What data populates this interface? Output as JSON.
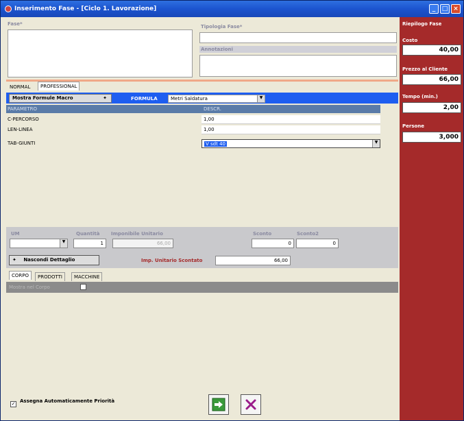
{
  "window": {
    "title": "Inserimento Fase - [Ciclo 1. Lavorazione]"
  },
  "form": {
    "fase_label": "Fase*",
    "tipologia_label": "Tipologia Fase*",
    "annotazioni_label": "Annotazioni"
  },
  "tabs_top": [
    "NORMAL",
    "PROFESSIONAL"
  ],
  "macro": {
    "toggle_label": "Mostra Formule Macro",
    "formula_label": "FORMULA",
    "formula_value": "Metri Saldatura"
  },
  "grid": {
    "headers": [
      "PARAMETRO",
      "DESCR."
    ],
    "rows": [
      {
        "param": "C-PERCORSO",
        "value": "1,00"
      },
      {
        "param": "LEN-LINEA",
        "value": "1,00"
      },
      {
        "param": "TAB-GIUNTI",
        "value": "V sdt 40"
      }
    ]
  },
  "detail": {
    "um_label": "UM",
    "quantita_label": "Quantità",
    "quantita_value": "1",
    "imponibile_label": "Imponibile Unitario",
    "imponibile_value": "66,00",
    "sconto_label": "Sconto",
    "sconto_value": "0",
    "sconto2_label": "Sconto2",
    "sconto2_value": "0",
    "hide_label": "Nascondi Dettaglio",
    "imp_scontato_label": "Imp. Unitario Scontato",
    "imp_scontato_value": "66,00"
  },
  "tabs_bottom": [
    "CORPO",
    "PRODOTTI",
    "MACCHINE"
  ],
  "corpo": {
    "mostra_label": "Mostra nel Corpo"
  },
  "riepilogo": {
    "title": "Riepilogo Fase",
    "costo_label": "Costo",
    "costo_value": "40,00",
    "prezzo_label": "Prezzo al Cliente",
    "prezzo_value": "66,00",
    "tempo_label": "Tempo (min.)",
    "tempo_value": "2,00",
    "persone_label": "Persone",
    "persone_value": "3,000"
  },
  "footer": {
    "assegna_label": "Assegna Automaticamente Priorità"
  },
  "colors": {
    "accent_blue": "#1e5ef0",
    "panel_red": "#a52a2a",
    "title_blue": "#1c54cf"
  },
  "icons": [
    "app-icon",
    "minimize-icon",
    "maximize-icon",
    "close-icon",
    "dropdown-arrow-icon",
    "confirm-arrow-icon",
    "cancel-x-icon",
    "checkbox-icon"
  ]
}
